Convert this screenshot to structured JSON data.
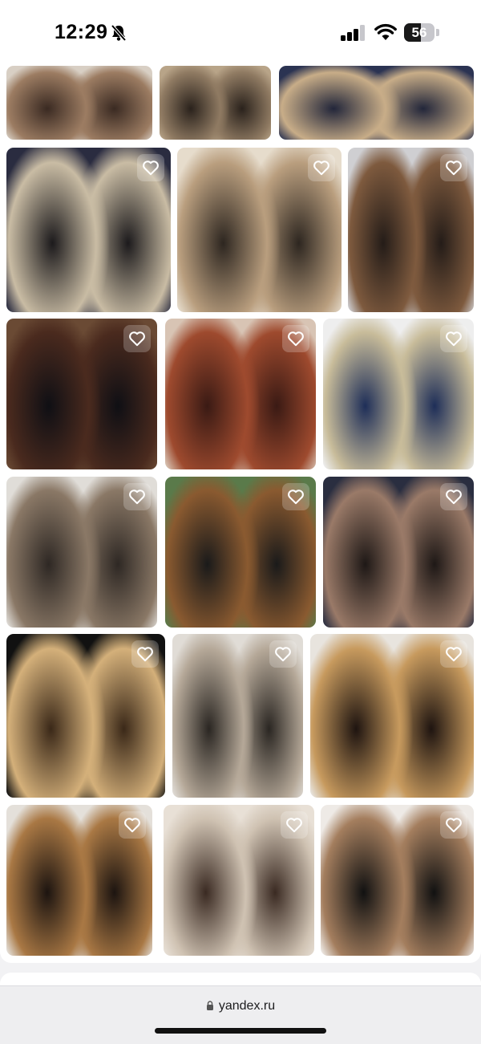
{
  "status_bar": {
    "time": "12:29",
    "battery_percent": "56",
    "battery_level": 0.56
  },
  "browser": {
    "url": "yandex.ru"
  },
  "gallery": {
    "tiles": [
      {
        "colors": [
          "#3a2a22",
          "#9c7c62",
          "#d8cfc4"
        ]
      },
      {
        "colors": [
          "#2a221c",
          "#8f7a62",
          "#b8a488"
        ]
      },
      {
        "colors": [
          "#22263a",
          "#c8ad88",
          "#2b3352"
        ]
      },
      {
        "colors": [
          "#1c1a1c",
          "#c9bca4",
          "#2a2c40"
        ]
      },
      {
        "colors": [
          "#2d2620",
          "#b99e7e",
          "#e6dccc"
        ]
      },
      {
        "colors": [
          "#241c18",
          "#7e5a3e",
          "#cfcfd2"
        ]
      },
      {
        "colors": [
          "#0f0f14",
          "#4a2a1e",
          "#6a4a34"
        ]
      },
      {
        "colors": [
          "#3a1a14",
          "#9e4a2e",
          "#d8c4b4"
        ]
      },
      {
        "colors": [
          "#1e2e58",
          "#c8bc9a",
          "#eeeeee"
        ]
      },
      {
        "colors": [
          "#2e2824",
          "#8a7866",
          "#e0ddd8"
        ]
      },
      {
        "colors": [
          "#1a1a1a",
          "#8a5a30",
          "#5a7a4a"
        ]
      },
      {
        "colors": [
          "#1e1816",
          "#9a7a68",
          "#2a2e40"
        ]
      },
      {
        "colors": [
          "#3a2818",
          "#d4b07a",
          "#111111"
        ]
      },
      {
        "colors": [
          "#2a2622",
          "#b5a898",
          "#e0dcd6"
        ]
      },
      {
        "colors": [
          "#1e1410",
          "#c79a5e",
          "#e8e4de"
        ]
      },
      {
        "colors": [
          "#1c1410",
          "#a97844",
          "#e4e0da"
        ]
      },
      {
        "colors": [
          "#3a2a22",
          "#cfc2b2",
          "#e8e0d6"
        ]
      },
      {
        "colors": [
          "#111111",
          "#a47e5e",
          "#eeeae6"
        ]
      }
    ]
  },
  "icons": {
    "favorite": "heart-outline-icon",
    "bell": "bell-slash-icon",
    "signal": "cellular-signal-icon",
    "wifi": "wifi-icon",
    "battery": "battery-icon",
    "lock": "lock-icon"
  }
}
